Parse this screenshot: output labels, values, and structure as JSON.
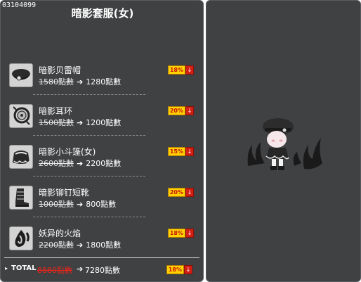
{
  "window": {
    "code": "03104099",
    "title": "暗影套服(女)"
  },
  "items": [
    {
      "name": "暗影贝雷帽",
      "original_price": "1580點數",
      "new_price": "1280點數",
      "discount": "18%",
      "icon": "beret-icon"
    },
    {
      "name": "暗影耳环",
      "original_price": "1500點數",
      "new_price": "1200點數",
      "discount": "20%",
      "icon": "earring-icon"
    },
    {
      "name": "暗影小斗篷(女)",
      "original_price": "2600點數",
      "new_price": "2200點數",
      "discount": "15%",
      "icon": "cape-icon"
    },
    {
      "name": "暗影铆钉短靴",
      "original_price": "1000點數",
      "new_price": "800點數",
      "discount": "20%",
      "icon": "boots-icon"
    },
    {
      "name": "妖异的火焰",
      "original_price": "2200點數",
      "new_price": "1800點數",
      "discount": "18%",
      "icon": "flame-icon"
    }
  ],
  "total": {
    "label": "TOTAL",
    "original_price": "8880點數",
    "new_price": "7280點數",
    "discount": "18%"
  },
  "symbols": {
    "arrow": "➔",
    "down": "↓",
    "pointer": "▸"
  },
  "colors": {
    "panel_bg": "#3f4143",
    "badge_bg": "#ffd200",
    "badge_text": "#c8140a",
    "total_original": "#e8251a"
  }
}
